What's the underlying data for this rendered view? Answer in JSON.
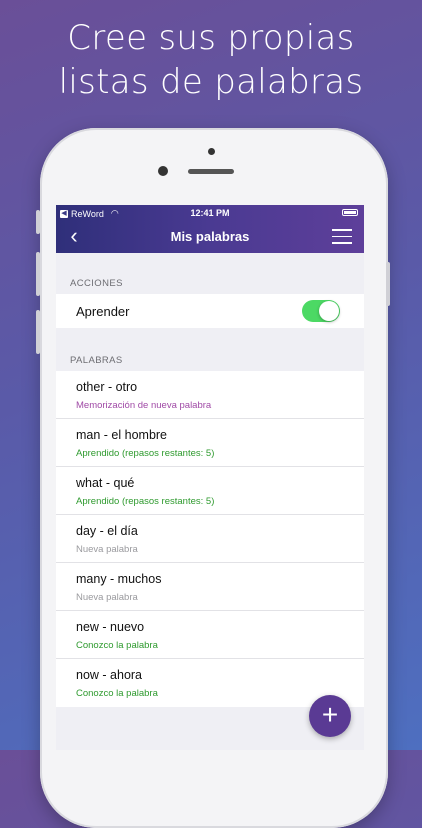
{
  "headline": {
    "line1": "Cree sus propias",
    "line2": "listas de palabras"
  },
  "statusbar": {
    "app": "ReWord",
    "time": "12:41 PM"
  },
  "navbar": {
    "back_icon": "‹",
    "title": "Mis palabras"
  },
  "actions": {
    "header": "ACCIONES",
    "learn_label": "Aprender",
    "learn_enabled": true
  },
  "words": {
    "header": "PALABRAS",
    "items": [
      {
        "word": "other - otro",
        "status": "Memorización de nueva palabra",
        "color": "#a04aa6"
      },
      {
        "word": "man - el hombre",
        "status": "Aprendido (repasos restantes: 5)",
        "color": "#2e9a2e"
      },
      {
        "word": "what - qué",
        "status": "Aprendido (repasos restantes: 5)",
        "color": "#2e9a2e"
      },
      {
        "word": "day - el día",
        "status": "Nueva palabra",
        "color": "#9a9a9e"
      },
      {
        "word": "many - muchos",
        "status": "Nueva palabra",
        "color": "#9a9a9e"
      },
      {
        "word": "new - nuevo",
        "status": "Conozco la palabra",
        "color": "#2e9a2e"
      },
      {
        "word": "now - ahora",
        "status": "Conozco la palabra",
        "color": "#2e9a2e"
      }
    ]
  },
  "fab": {
    "label": "+"
  },
  "colors": {
    "accent": "#5a3a94",
    "toggle_on": "#4cd964"
  }
}
